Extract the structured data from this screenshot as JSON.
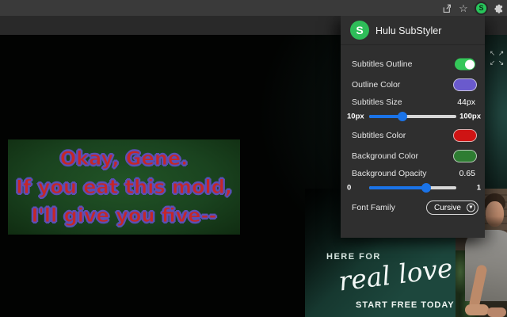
{
  "browser": {
    "toolbar_icons": [
      "share-icon",
      "bookmark-star-icon",
      "substyler-extension-icon",
      "extensions-puzzle-icon"
    ],
    "star_glyph": "☆",
    "extension_badge_letter": "S"
  },
  "popup": {
    "logo_letter": "S",
    "title": "Hulu SubStyler",
    "controls": {
      "subtitles_outline": {
        "label": "Subtitles Outline",
        "enabled": true
      },
      "outline_color": {
        "label": "Outline Color",
        "color": "#6a5acd"
      },
      "subtitles_size": {
        "label": "Subtitles Size",
        "value": "44px",
        "min_label": "10px",
        "max_label": "100px",
        "fill": "38%"
      },
      "subtitles_color": {
        "label": "Subtitles Color",
        "color": "#cf1414"
      },
      "background_color": {
        "label": "Background Color",
        "color": "#2e7d32"
      },
      "background_opacity": {
        "label": "Background Opacity",
        "value": "0.65",
        "min_label": "0",
        "max_label": "1",
        "fill": "65%"
      },
      "font_family": {
        "label": "Font Family",
        "value": "Cursive"
      }
    },
    "accent_colors": {
      "toggle_on": "#34c759",
      "slider": "#1a73e8"
    }
  },
  "video": {
    "subtitle_lines": [
      "Okay, Gene.",
      "If you eat this mold,",
      "I'll give you five--"
    ],
    "subtitle_text_color": "#c62627",
    "subtitle_outline_color": "#5b4fb5",
    "subtitle_background_color": "#1e4a22",
    "expand_arrows": [
      "↖",
      "↗",
      "↙",
      "↘"
    ]
  },
  "ad": {
    "line1": "HERE FOR",
    "line2": "real love",
    "cta": "START FREE TODAY",
    "background_color": "#1d473d"
  }
}
